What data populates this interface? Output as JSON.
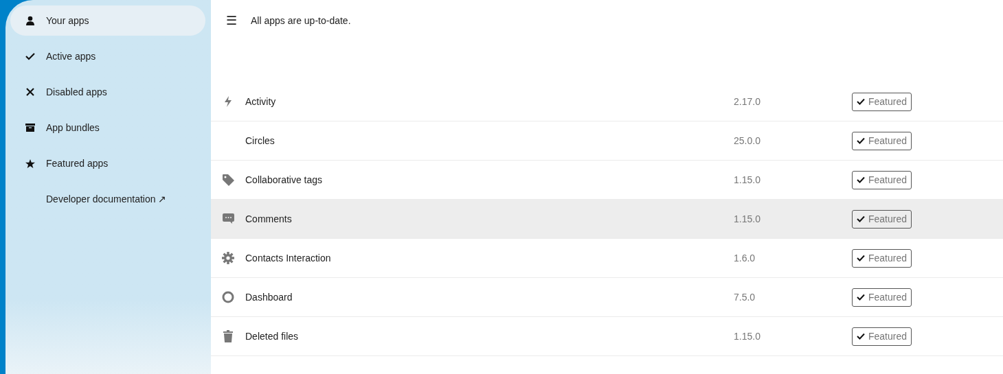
{
  "sidebar": {
    "items": [
      {
        "label": "Your apps",
        "selected": true
      },
      {
        "label": "Active apps",
        "selected": false
      },
      {
        "label": "Disabled apps",
        "selected": false
      },
      {
        "label": "App bundles",
        "selected": false
      },
      {
        "label": "Featured apps",
        "selected": false
      },
      {
        "label": "Developer documentation ↗",
        "selected": false
      }
    ]
  },
  "header": {
    "menu_icon": "☰",
    "message": "All apps are up-to-date."
  },
  "apps": {
    "rows": [
      {
        "name": "Activity",
        "version": "2.17.0",
        "badge": "Featured",
        "selected": false
      },
      {
        "name": "Circles",
        "version": "25.0.0",
        "badge": "Featured",
        "selected": false
      },
      {
        "name": "Collaborative tags",
        "version": "1.15.0",
        "badge": "Featured",
        "selected": false
      },
      {
        "name": "Comments",
        "version": "1.15.0",
        "badge": "Featured",
        "selected": true
      },
      {
        "name": "Contacts Interaction",
        "version": "1.6.0",
        "badge": "Featured",
        "selected": false
      },
      {
        "name": "Dashboard",
        "version": "7.5.0",
        "badge": "Featured",
        "selected": false
      },
      {
        "name": "Deleted files",
        "version": "1.15.0",
        "badge": "Featured",
        "selected": false
      }
    ]
  }
}
